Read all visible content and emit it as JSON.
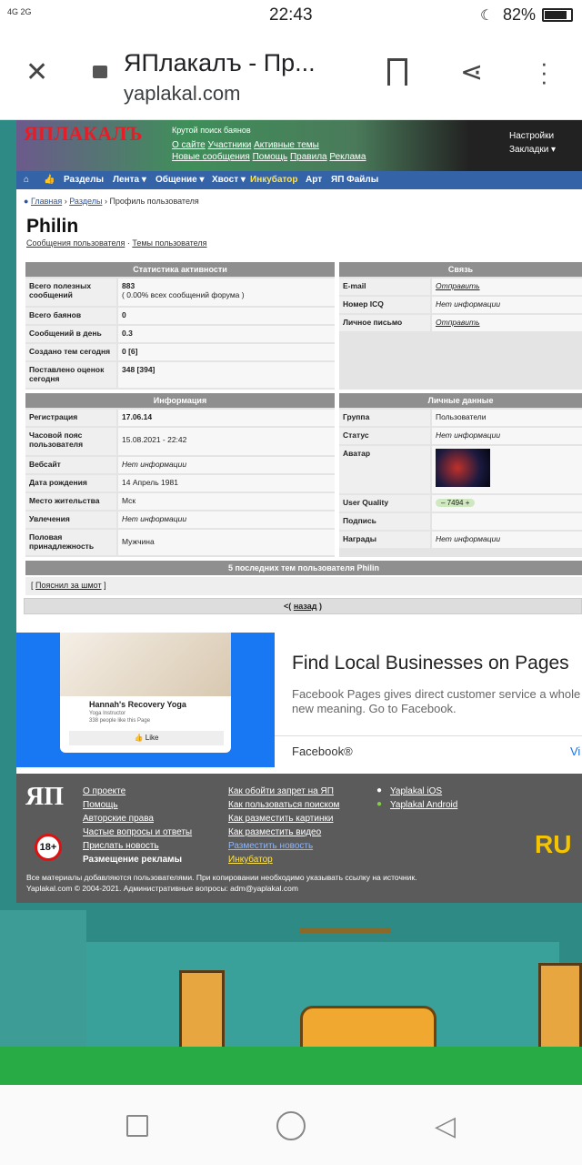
{
  "status": {
    "network": "4G 2G",
    "time": "22:43",
    "battery": "82%"
  },
  "browser": {
    "title": "ЯПлакалъ - Пр...",
    "url": "yaplakal.com"
  },
  "header": {
    "tagline": "Крутой поиск баянов",
    "links": [
      "О сайте",
      "Участники",
      "Активные темы",
      "Новые сообщения",
      "Помощь",
      "Правила",
      "Реклама"
    ],
    "right": [
      "Настройки",
      "Закладки ▾"
    ]
  },
  "nav": [
    "Разделы",
    "Лента ▾",
    "Общение ▾",
    "Хвост ▾",
    "Инкубатор",
    "Арт",
    "ЯП Файлы"
  ],
  "breadcrumb": {
    "home": "Главная",
    "sections": "Разделы",
    "current": "Профиль пользователя"
  },
  "profile": {
    "name": "Philin",
    "links": [
      "Сообщения пользователя",
      "Темы пользователя"
    ]
  },
  "stats": {
    "title": "Статистика активности",
    "rows": [
      {
        "k": "Всего полезных сообщений",
        "v": "883",
        "v2": "( 0.00% всех сообщений форума )"
      },
      {
        "k": "Всего баянов",
        "v": "0"
      },
      {
        "k": "Сообщений в день",
        "v": "0.3"
      },
      {
        "k": "Создано тем сегодня",
        "v": "0 [6]"
      },
      {
        "k": "Поставлено оценок сегодня",
        "v": "348 [394]"
      }
    ]
  },
  "contact": {
    "title": "Связь",
    "rows": [
      {
        "k": "E-mail",
        "v": "Отправить"
      },
      {
        "k": "Номер ICQ",
        "v": "Нет информации"
      },
      {
        "k": "Личное письмо",
        "v": "Отправить"
      }
    ]
  },
  "info": {
    "title": "Информация",
    "rows": [
      {
        "k": "Регистрация",
        "v": "17.06.14"
      },
      {
        "k": "Часовой пояс пользователя",
        "v": "15.08.2021 - 22:42"
      },
      {
        "k": "Вебсайт",
        "v": "Нет информации"
      },
      {
        "k": "Дата рождения",
        "v": "14 Апрель 1981"
      },
      {
        "k": "Место жительства",
        "v": "Мск"
      },
      {
        "k": "Увлечения",
        "v": "Нет информации"
      },
      {
        "k": "Половая принадлежность",
        "v": "Мужчина"
      }
    ]
  },
  "personal": {
    "title": "Личные данные",
    "rows": [
      {
        "k": "Группа",
        "v": "Пользователи"
      },
      {
        "k": "Статус",
        "v": "Нет информации"
      },
      {
        "k": "Аватар",
        "v": ""
      },
      {
        "k": "User Quality",
        "v": "7494"
      },
      {
        "k": "Подпись",
        "v": ""
      },
      {
        "k": "Награды",
        "v": "Нет информации"
      }
    ]
  },
  "recent": {
    "title": "5 последних тем пользователя Philin",
    "joke": "Пояснил за шмот",
    "back": "назад"
  },
  "ad": {
    "title": "Find Local Businesses on Pages",
    "text": "Facebook Pages gives direct customer service a whole new meaning. Go to Facebook.",
    "source": "Facebook®",
    "cta": "Vi",
    "card_name": "Hannah's Recovery Yoga",
    "card_sub": "Yoga Instructor",
    "card_likes": "338 people like this Page",
    "card_like": "Like"
  },
  "footer": {
    "col1": [
      "О проекте",
      "Помощь",
      "Авторские права",
      "Частые вопросы и ответы",
      "Прислать новость",
      "Размещение рекламы"
    ],
    "col2": [
      "Как обойти запрет на ЯП",
      "Как пользоваться поиском",
      "Как разместить картинки",
      "Как разместить видео",
      "Разместить новость",
      "Инкубатор"
    ],
    "col3": [
      "Yaplakal iOS",
      "Yaplakal Android"
    ],
    "age": "18+",
    "note1": "Все материалы добавляются пользователями. При копировании необходимо указывать ссылку на источник.",
    "note2": "Yaplakal.com © 2004-2021. Административные вопросы: adm@yaplakal.com"
  }
}
